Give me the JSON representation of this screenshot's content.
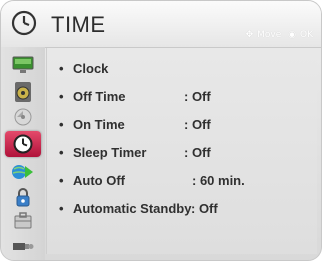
{
  "header": {
    "title": "TIME",
    "hint_move": "Move",
    "hint_ok": "OK"
  },
  "sidebar": {
    "items": [
      {
        "icon": "picture-icon"
      },
      {
        "icon": "sound-icon"
      },
      {
        "icon": "channel-icon"
      },
      {
        "icon": "time-icon",
        "active": true
      },
      {
        "icon": "network-icon"
      },
      {
        "icon": "lock-icon"
      },
      {
        "icon": "option-icon"
      },
      {
        "icon": "input-icon"
      }
    ],
    "active_color": "#c8204a"
  },
  "menu": {
    "bullet": "•",
    "items": [
      {
        "label": "Clock",
        "value": ""
      },
      {
        "label": "Off Time",
        "value": ": Off"
      },
      {
        "label": "On Time",
        "value": ": Off"
      },
      {
        "label": "Sleep Timer",
        "value": ": Off"
      },
      {
        "label": "Auto Off",
        "value": ": 60 min."
      },
      {
        "label": "Automatic Standby",
        "value": ": Off"
      }
    ]
  }
}
